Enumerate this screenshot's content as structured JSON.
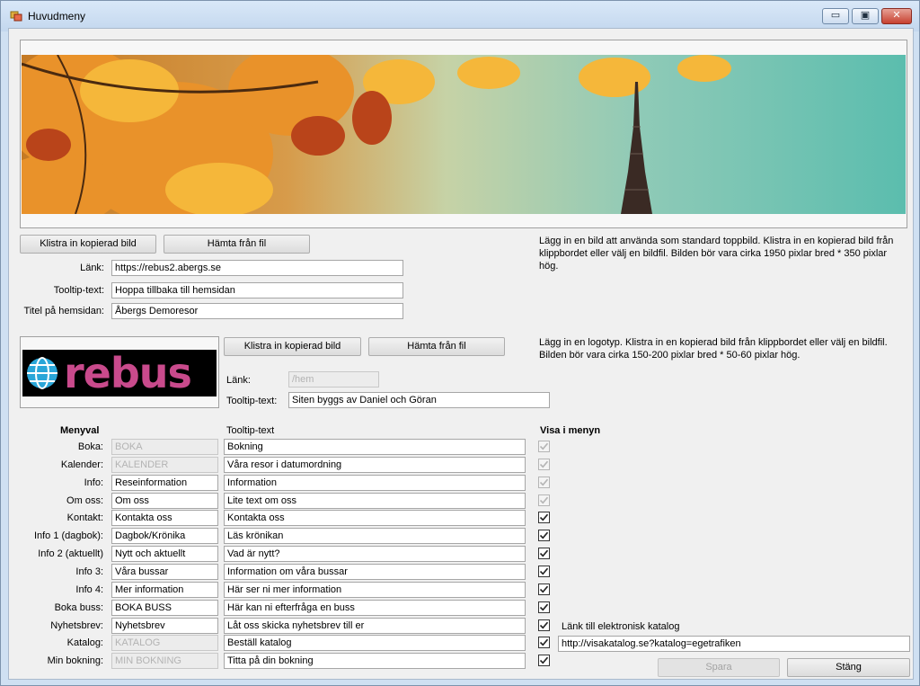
{
  "window": {
    "title": "Huvudmeny"
  },
  "titlebar_buttons": {
    "minimize": "▭",
    "maximize": "▣",
    "close": "✕"
  },
  "banner_section": {
    "paste_button": "Klistra in kopierad bild",
    "file_button": "Hämta från fil",
    "help": "Lägg in en bild att använda som standard toppbild. Klistra in en kopierad bild från klippbordet eller välj en bildfil. Bilden bör vara cirka 1950 pixlar bred * 350 pixlar hög.",
    "link_label": "Länk:",
    "link_value": "https://rebus2.abergs.se",
    "tooltip_label": "Tooltip-text:",
    "tooltip_value": "Hoppa tillbaka till hemsidan",
    "site_title_label": "Titel på hemsidan:",
    "site_title_value": "Åbergs Demoresor"
  },
  "logo_section": {
    "logo_text": "rebus",
    "paste_button": "Klistra in kopierad bild",
    "file_button": "Hämta från fil",
    "help": "Lägg in en logotyp. Klistra in en kopierad bild från klippbordet eller välj en bildfil. Bilden bör vara cirka 150-200 pixlar bred * 50-60 pixlar hög.",
    "link_label": "Länk:",
    "link_value": "/hem",
    "tooltip_label": "Tooltip-text:",
    "tooltip_value": "Siten byggs av Daniel och Göran"
  },
  "menu": {
    "header_menyval": "Menyval",
    "header_tooltip": "Tooltip-text",
    "header_visa": "Visa i menyn",
    "rows": [
      {
        "label": "Boka:",
        "value": "BOKA",
        "tooltip": "Bokning",
        "checked": true,
        "value_disabled": true,
        "check_disabled": true
      },
      {
        "label": "Kalender:",
        "value": "KALENDER",
        "tooltip": "Våra resor i datumordning",
        "checked": true,
        "value_disabled": true,
        "check_disabled": true
      },
      {
        "label": "Info:",
        "value": "Reseinformation",
        "tooltip": "Information",
        "checked": true,
        "value_disabled": false,
        "check_disabled": true
      },
      {
        "label": "Om oss:",
        "value": "Om oss",
        "tooltip": "Lite text om oss",
        "checked": true,
        "value_disabled": false,
        "check_disabled": true
      },
      {
        "label": "Kontakt:",
        "value": "Kontakta oss",
        "tooltip": "Kontakta oss",
        "checked": true,
        "value_disabled": false,
        "check_disabled": false
      },
      {
        "label": "Info 1 (dagbok):",
        "value": "Dagbok/Krönika",
        "tooltip": "Läs krönikan",
        "checked": true,
        "value_disabled": false,
        "check_disabled": false
      },
      {
        "label": "Info 2 (aktuellt)",
        "value": "Nytt och aktuellt",
        "tooltip": "Vad är nytt?",
        "checked": true,
        "value_disabled": false,
        "check_disabled": false
      },
      {
        "label": "Info 3:",
        "value": "Våra bussar",
        "tooltip": "Information om våra bussar",
        "checked": true,
        "value_disabled": false,
        "check_disabled": false
      },
      {
        "label": "Info 4:",
        "value": "Mer information",
        "tooltip": "Här ser ni mer information",
        "checked": true,
        "value_disabled": false,
        "check_disabled": false
      },
      {
        "label": "Boka buss:",
        "value": "BOKA BUSS",
        "tooltip": "Här kan ni efterfråga en buss",
        "checked": true,
        "value_disabled": false,
        "check_disabled": false
      },
      {
        "label": "Nyhetsbrev:",
        "value": "Nyhetsbrev",
        "tooltip": "Låt oss skicka nyhetsbrev till er",
        "checked": true,
        "value_disabled": false,
        "check_disabled": false
      },
      {
        "label": "Katalog:",
        "value": "KATALOG",
        "tooltip": "Beställ katalog",
        "checked": true,
        "value_disabled": true,
        "check_disabled": false
      },
      {
        "label": "Min bokning:",
        "value": "MIN BOKNING",
        "tooltip": "Titta på din bokning",
        "checked": true,
        "value_disabled": true,
        "check_disabled": false
      }
    ]
  },
  "catalog": {
    "label": "Länk till elektronisk katalog",
    "value": "http://visakatalog.se?katalog=egetrafiken"
  },
  "footer": {
    "save": "Spara",
    "close": "Stäng"
  }
}
